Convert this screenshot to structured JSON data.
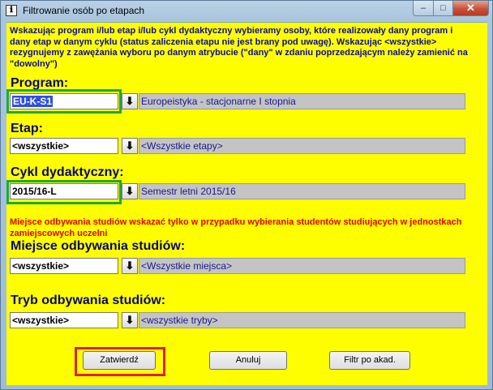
{
  "window": {
    "title": "Filtrowanie osób po etapach",
    "app_icon_glyph": "ℹ",
    "min_glyph": "‒",
    "max_glyph": "□",
    "close_glyph": "✕"
  },
  "info_text": "Wskazując program i/lub etap i/lub cykl dydaktyczny wybieramy osoby, które realizowały dany program i dany etap w danym cyklu (status zaliczenia etapu nie jest brany pod uwagę). Wskazując <wszystkie> rezygnujemy z zawężania wyboru po danym atrybucie (\"dany\" w zdaniu poprzedzającym należy zamienić na \"dowolny\")",
  "warning_text": "Miejsce odbywania studiów wskazać tylko w przypadku wybierania studentów studiujących w jednostkach zamiejscowych uczelni",
  "program": {
    "label": "Program:",
    "value": "EU-K-S1",
    "description": "Europeistyka - stacjonarne I stopnia"
  },
  "etap": {
    "label": "Etap:",
    "value": "<wszystkie>",
    "description": "<Wszystkie etapy>"
  },
  "cykl": {
    "label": "Cykl dydaktyczny:",
    "value": "2015/16-L",
    "description": "Semestr letni 2015/16"
  },
  "miejsce": {
    "label": "Miejsce odbywania studiów:",
    "value": "<wszystkie>",
    "description": "<Wszystkie miejsca>"
  },
  "tryb": {
    "label": "Tryb odbywania studiów:",
    "value": "<wszystkie>",
    "description": "<wszystkie tryby>"
  },
  "dropdown_glyph": "⬇",
  "buttons": {
    "confirm": "Zatwierdź",
    "cancel": "Anuluj",
    "filter": "Filtr po akad."
  },
  "colors": {
    "background": "#fefe00",
    "info_text": "#0b0b9c",
    "warning_text": "#e00000",
    "highlight_green": "#1ea83c",
    "highlight_red": "#e0202a"
  }
}
